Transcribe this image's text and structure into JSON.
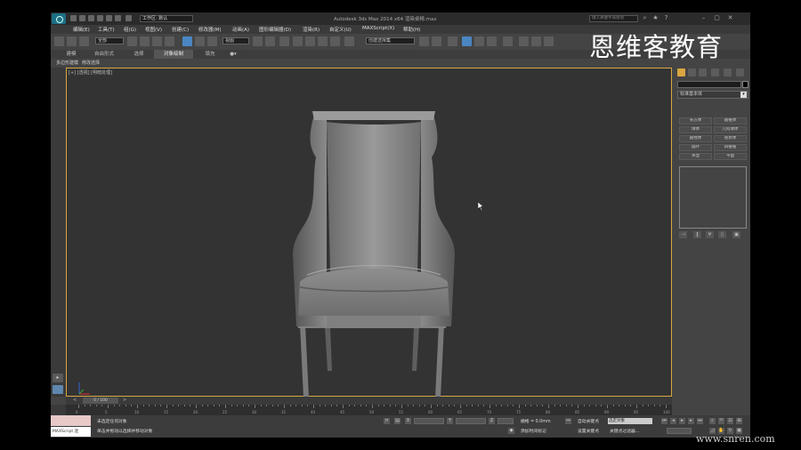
{
  "titlebar": {
    "workspace": "工作区: 默认",
    "app_title": "Autodesk 3ds Max  2014 x64       渲染桌椅.max",
    "search_placeholder": "键入关键字或短语"
  },
  "menu": [
    "编辑(E)",
    "工具(T)",
    "组(G)",
    "视图(V)",
    "创建(C)",
    "修改器(M)",
    "动画(A)",
    "图形编辑器(D)",
    "渲染(R)",
    "自定义(U)",
    "MAXScript(X)",
    "帮助(H)"
  ],
  "toolbar": {
    "filter_select": "全部",
    "view_select": "视图",
    "named_selection": "创建选择集"
  },
  "ribbon_tabs": [
    "建模",
    "自由形式",
    "选择",
    "对象绘制",
    "填充"
  ],
  "ribbon_active": 3,
  "subtabs": [
    "多边形建模",
    "修改选择"
  ],
  "viewport": {
    "label": "[+] [透视] [明暗处理]"
  },
  "command_panel": {
    "dropdown": "标准基本体",
    "buttons": [
      [
        "长方体",
        "圆锥体"
      ],
      [
        "球体",
        "几何球体"
      ],
      [
        "圆柱体",
        "管状体"
      ],
      [
        "圆环",
        "四棱锥"
      ],
      [
        "茶壶",
        "平面"
      ]
    ]
  },
  "timeline": {
    "slider": "0 / 100",
    "ticks": [
      "0",
      "5",
      "10",
      "15",
      "20",
      "25",
      "30",
      "35",
      "40",
      "45",
      "50",
      "55",
      "60",
      "65",
      "70",
      "75",
      "80",
      "85",
      "90",
      "95",
      "100"
    ]
  },
  "statusbar": {
    "maxscript": "MAXScript 迷",
    "line1": "未选定任何对象",
    "line2": "单击并拖动以选择并移动对象",
    "grid": "栅格 = 0.0mm",
    "add_time_tag": "添加时间标记",
    "auto_key": "自动关键点",
    "set_key": "设置关键点",
    "key_filter": "选定对象",
    "key_filter_label": "关键点过滤器..."
  },
  "overlay": {
    "brand": "恩维客教育",
    "website": "www.snren.com"
  },
  "colors": {
    "viewport_bg": "#333333",
    "viewport_border": "#d8a640",
    "ui_bg": "#444444",
    "selected_tool": "#4a86c2"
  }
}
